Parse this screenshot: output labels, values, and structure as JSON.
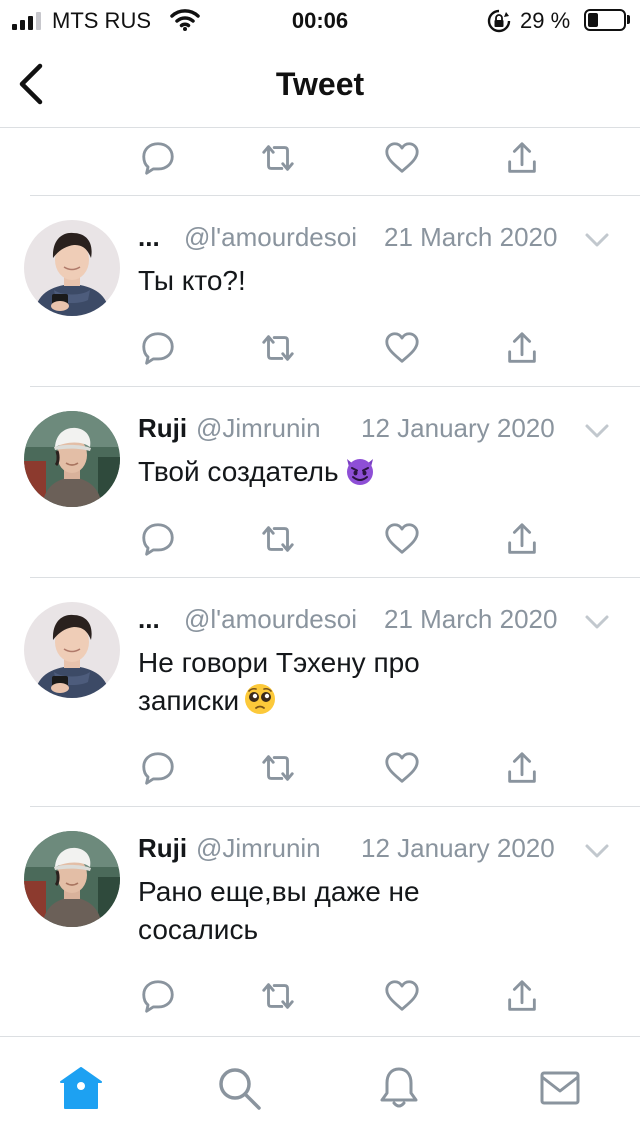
{
  "status_bar": {
    "carrier": "MTS RUS",
    "time": "00:06",
    "battery_percent": "29 %",
    "battery_level": 0.29
  },
  "header": {
    "title": "Tweet"
  },
  "tweets": [
    {
      "name": "...",
      "handle": "@l'amourdesoi",
      "date": "21 March 2020",
      "text": "Ты кто?!",
      "avatar_icon": "avatar-boy-blue-sweater"
    },
    {
      "name": "Ruji",
      "handle": "@Jimrunin",
      "date": "12 January 2020",
      "text": "Твой создатель",
      "emoji": "smiling-imp-emoji",
      "avatar_icon": "avatar-boy-white-cap"
    },
    {
      "name": "...",
      "handle": "@l'amourdesoi",
      "date": "21 March 2020",
      "text": "Не говори Тэхену про записки",
      "emoji": "pleading-face-emoji",
      "avatar_icon": "avatar-boy-blue-sweater"
    },
    {
      "name": "Ruji",
      "handle": "@Jimrunin",
      "date": "12 January 2020",
      "text": "Рано еще,вы даже не сосались",
      "avatar_icon": "avatar-boy-white-cap"
    }
  ],
  "tab_bar": {
    "tabs": [
      "home-icon",
      "search-icon",
      "notifications-icon",
      "messages-icon"
    ],
    "active_color": "#1da1f2",
    "inactive_color": "#8a949e"
  },
  "colors": {
    "icon_gray": "#8a949e",
    "divider": "#dcdfe2"
  }
}
